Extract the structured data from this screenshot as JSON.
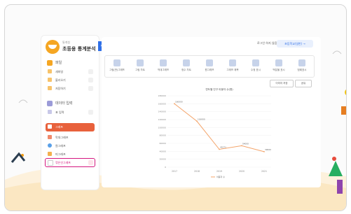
{
  "app": {
    "logo_sub": "통계청",
    "title": "초등용 통계분석"
  },
  "sidebar": {
    "sections": [
      {
        "label": "파일"
      },
      {
        "label": "데이터 입력"
      },
      {
        "label": "그래프"
      }
    ],
    "file_items": [
      {
        "label": "새파일"
      },
      {
        "label": "불러오기"
      },
      {
        "label": "저장하기"
      }
    ],
    "data_items": [
      {
        "label": "표 입력"
      }
    ],
    "graph_items": [
      {
        "label": "막대그래프"
      },
      {
        "label": "원그래프"
      },
      {
        "label": "띠그래프"
      },
      {
        "label": "꺾은선그래프"
      }
    ]
  },
  "topbar": {
    "text": "로그인 하지 않음",
    "button": "초등학교(일반) →"
  },
  "chart_types": [
    {
      "label": "그림(반)그래프"
    },
    {
      "label": "그림 차트"
    },
    {
      "label": "막대그래프"
    },
    {
      "label": "정수 차트"
    },
    {
      "label": "원그래프"
    },
    {
      "label": "그래프 제목"
    },
    {
      "label": "수정 표시"
    },
    {
      "label": "백분율 표시"
    },
    {
      "label": "범례표시"
    }
  ],
  "buttons": {
    "image_save": "이미지 저장",
    "share": "공유"
  },
  "colors": {
    "accent": "#e8613c",
    "blue": "#2e6fe8",
    "line": "#f4a46a",
    "highlight": "#d4167f"
  },
  "chart_data": {
    "type": "line",
    "title": "연도별 인구 이동자 수(명)",
    "categories": [
      "2017",
      "2018",
      "2019",
      "2020",
      "2021"
    ],
    "series": [
      {
        "name": "이동자 수",
        "values": [
          160000,
          116000,
          45000,
          54000,
          39000
        ]
      }
    ],
    "ylim": [
      0,
      180000
    ],
    "yticks": [
      0,
      20000,
      40000,
      60000,
      80000,
      100000,
      120000,
      140000,
      160000,
      180000
    ],
    "data_labels": [
      "160000",
      "116000",
      "45271",
      "54000",
      "39000"
    ],
    "grid": true,
    "legend": "bottom"
  }
}
